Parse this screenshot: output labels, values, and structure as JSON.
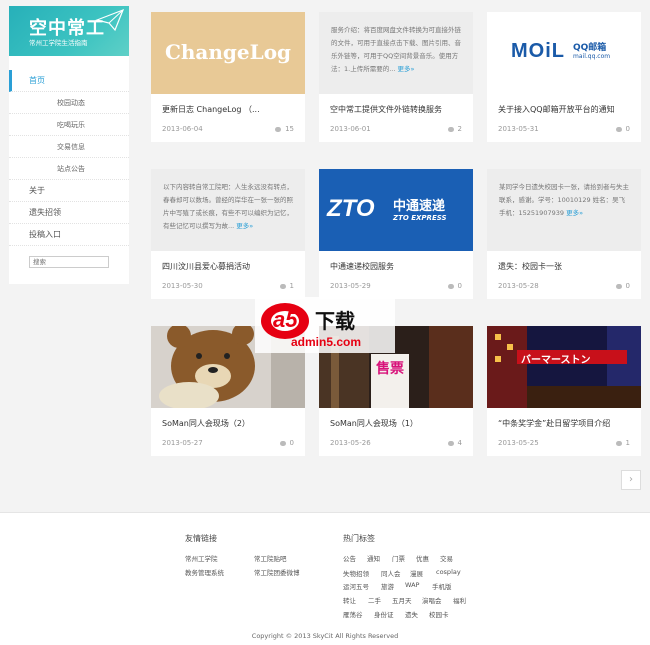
{
  "sidebar": {
    "logo_title": "空中常工",
    "logo_subtitle": "常州工学院生活指南",
    "nav": [
      {
        "label": "首页",
        "level": "top",
        "active": true
      },
      {
        "label": "校园动态",
        "level": "sub"
      },
      {
        "label": "吃喝玩乐",
        "level": "sub"
      },
      {
        "label": "交易信息",
        "level": "sub"
      },
      {
        "label": "站点公告",
        "level": "sub"
      },
      {
        "label": "关于",
        "level": "top"
      },
      {
        "label": "遗失招领",
        "level": "top"
      },
      {
        "label": "投稿入口",
        "level": "top"
      }
    ],
    "search_placeholder": "搜索"
  },
  "cards": [
    {
      "title": "更新日志 ChangeLog （...",
      "date": "2013-06-04",
      "comments": "15",
      "thumb_text": "ChangeLog"
    },
    {
      "title": "空中常工提供文件外链转换服务",
      "date": "2013-06-01",
      "comments": "2",
      "excerpt": "服务介绍：将百度网盘文件转换为可直接外链的文件，可用于直接点击下载、图片引用、音乐外链等，可用于QQ空间背景音乐。使用方法：1.上传所需要的...",
      "more": "更多»"
    },
    {
      "title": "关于接入QQ邮箱开放平台的通知",
      "date": "2013-05-31",
      "comments": "0",
      "thumb_logo": "MOiL",
      "thumb_logo_cn": "QQ邮箱",
      "thumb_logo_url": "mail.qq.com"
    },
    {
      "title": "四川汶川县爱心募捐活动",
      "date": "2013-05-30",
      "comments": "1",
      "excerpt": "以下内容转自常工院吧：人生永远没有转点，春春却可以数场。曾经的岸华在一张一张的照片中写殖了或长痕，有些不可以编织为记忆，有些记忆可以撰写为故...",
      "more": "更多»"
    },
    {
      "title": "中通速递校园服务",
      "date": "2013-05-29",
      "comments": "0",
      "thumb_logo": "ZTO",
      "thumb_logo_cn": "中通速递",
      "thumb_logo_en": "ZTO EXPRESS"
    },
    {
      "title": "遗失：校园卡一张",
      "date": "2013-05-28",
      "comments": "0",
      "excerpt": "某同学今日遗失校园卡一张，请拾到者与失主联系，感谢。学号：10010129 姓名：吴飞 手机：15251907939",
      "more": "更多»"
    },
    {
      "title": "SoMan同人会现场（2）",
      "date": "2013-05-27",
      "comments": "0"
    },
    {
      "title": "SoMan同人会现场（1）",
      "date": "2013-05-26",
      "comments": "4",
      "thumb_sign": "售票"
    },
    {
      "title": "“中条奖学金”赴日留学项目介绍",
      "date": "2013-05-25",
      "comments": "1",
      "thumb_sign": "バーマーストン"
    }
  ],
  "pager": {
    "next": "›"
  },
  "watermark": {
    "brand": "a5",
    "cn": "下载",
    "url": "admin5.com"
  },
  "footer": {
    "links_title": "友情链接",
    "links": [
      "常州工学院",
      "常工院贴吧",
      "教务管理系统",
      "常工院团委微博"
    ],
    "tags_title": "热门标签",
    "tags": [
      "公告",
      "通知",
      "门票",
      "优惠",
      "交易",
      "失物招领",
      "同人会",
      "漫展",
      "cosplay",
      "运河五号",
      "旅游",
      "WAP",
      "手机版",
      "转让",
      "二手",
      "五月天",
      "演唱会",
      "福利",
      "雁荡谷",
      "身份证",
      "遗失",
      "校园卡"
    ],
    "copyright": "Copyright © 2013 SkyCit All Rights Reserved"
  }
}
